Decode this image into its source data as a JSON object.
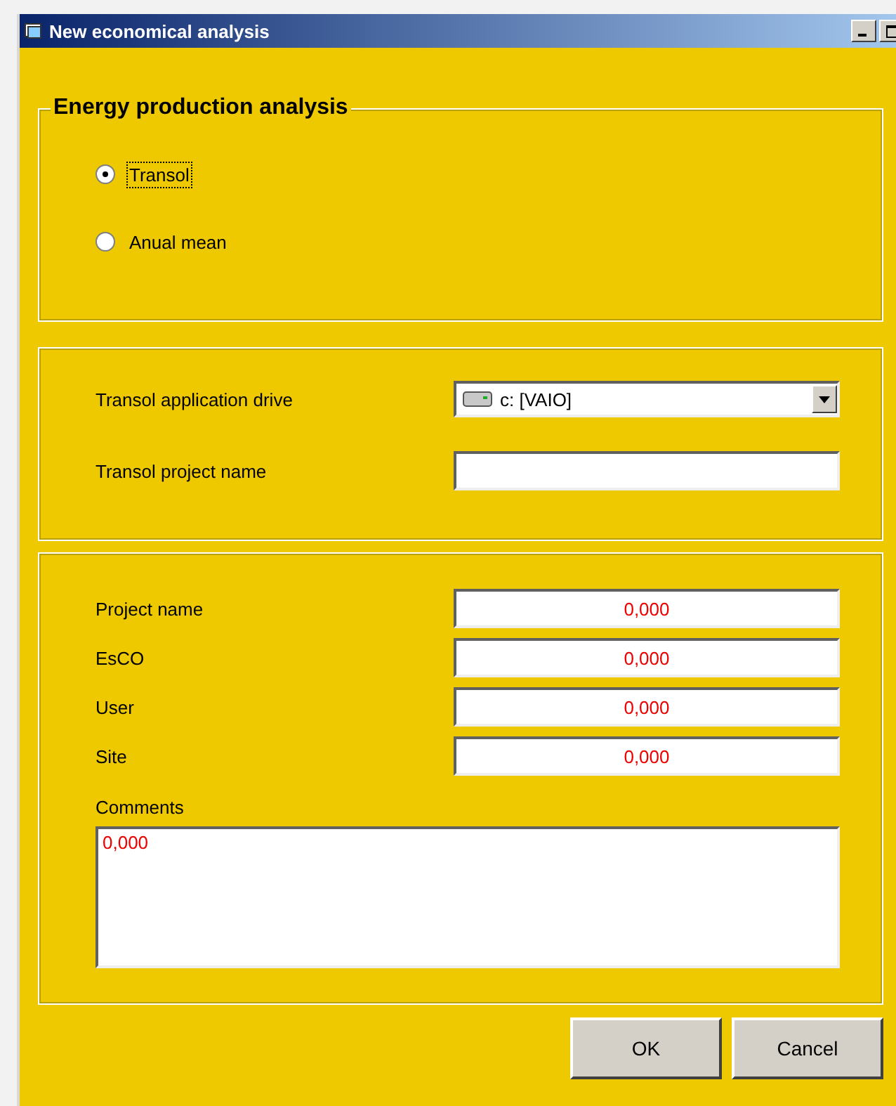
{
  "window": {
    "title": "New economical analysis"
  },
  "energy_group": {
    "legend": "Energy production analysis",
    "options": [
      {
        "label": "Transol",
        "selected": true,
        "focused": true
      },
      {
        "label": "Anual mean",
        "selected": false,
        "focused": false
      }
    ]
  },
  "transol_group": {
    "drive": {
      "label": "Transol application drive",
      "value": "c: [VAIO]"
    },
    "project": {
      "label": "Transol project name"
    }
  },
  "project_group": {
    "fields": [
      {
        "label": "Project name",
        "value": "0,000"
      },
      {
        "label": "EsCO",
        "value": "0,000"
      },
      {
        "label": "User",
        "value": "0,000"
      },
      {
        "label": "Site",
        "value": "0,000"
      }
    ],
    "comments": {
      "label": "Comments",
      "value": "0,000"
    }
  },
  "buttons": [
    {
      "label": "OK"
    },
    {
      "label": "Cancel"
    }
  ]
}
